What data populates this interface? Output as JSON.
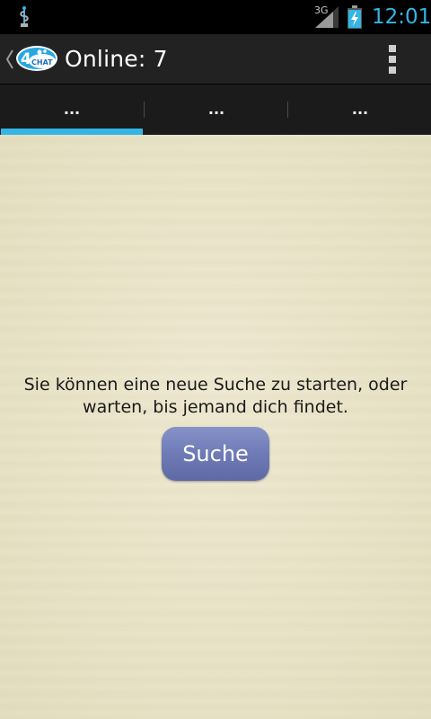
{
  "status_bar": {
    "time": "12:01",
    "network_type": "3G",
    "icons": [
      "usb-debug-icon",
      "signal-icon",
      "battery-charging-icon"
    ]
  },
  "action_bar": {
    "title": "Online: 7",
    "logo_text": "4CHAT",
    "icons": [
      "back-chevron-icon",
      "app-logo-icon",
      "overflow-menu-icon"
    ]
  },
  "tabs": [
    {
      "label": "...",
      "selected": true
    },
    {
      "label": "...",
      "selected": false
    },
    {
      "label": "...",
      "selected": false
    }
  ],
  "main": {
    "message_line1": "Sie können eine neue Suche zu starten, oder",
    "message_line2": "warten, bis jemand dich findet.",
    "search_button_label": "Suche"
  },
  "colors": {
    "accent": "#33b5e5",
    "action_bar_bg": "#222222",
    "content_bg": "#ebe5ca",
    "button": "#7580bb"
  }
}
